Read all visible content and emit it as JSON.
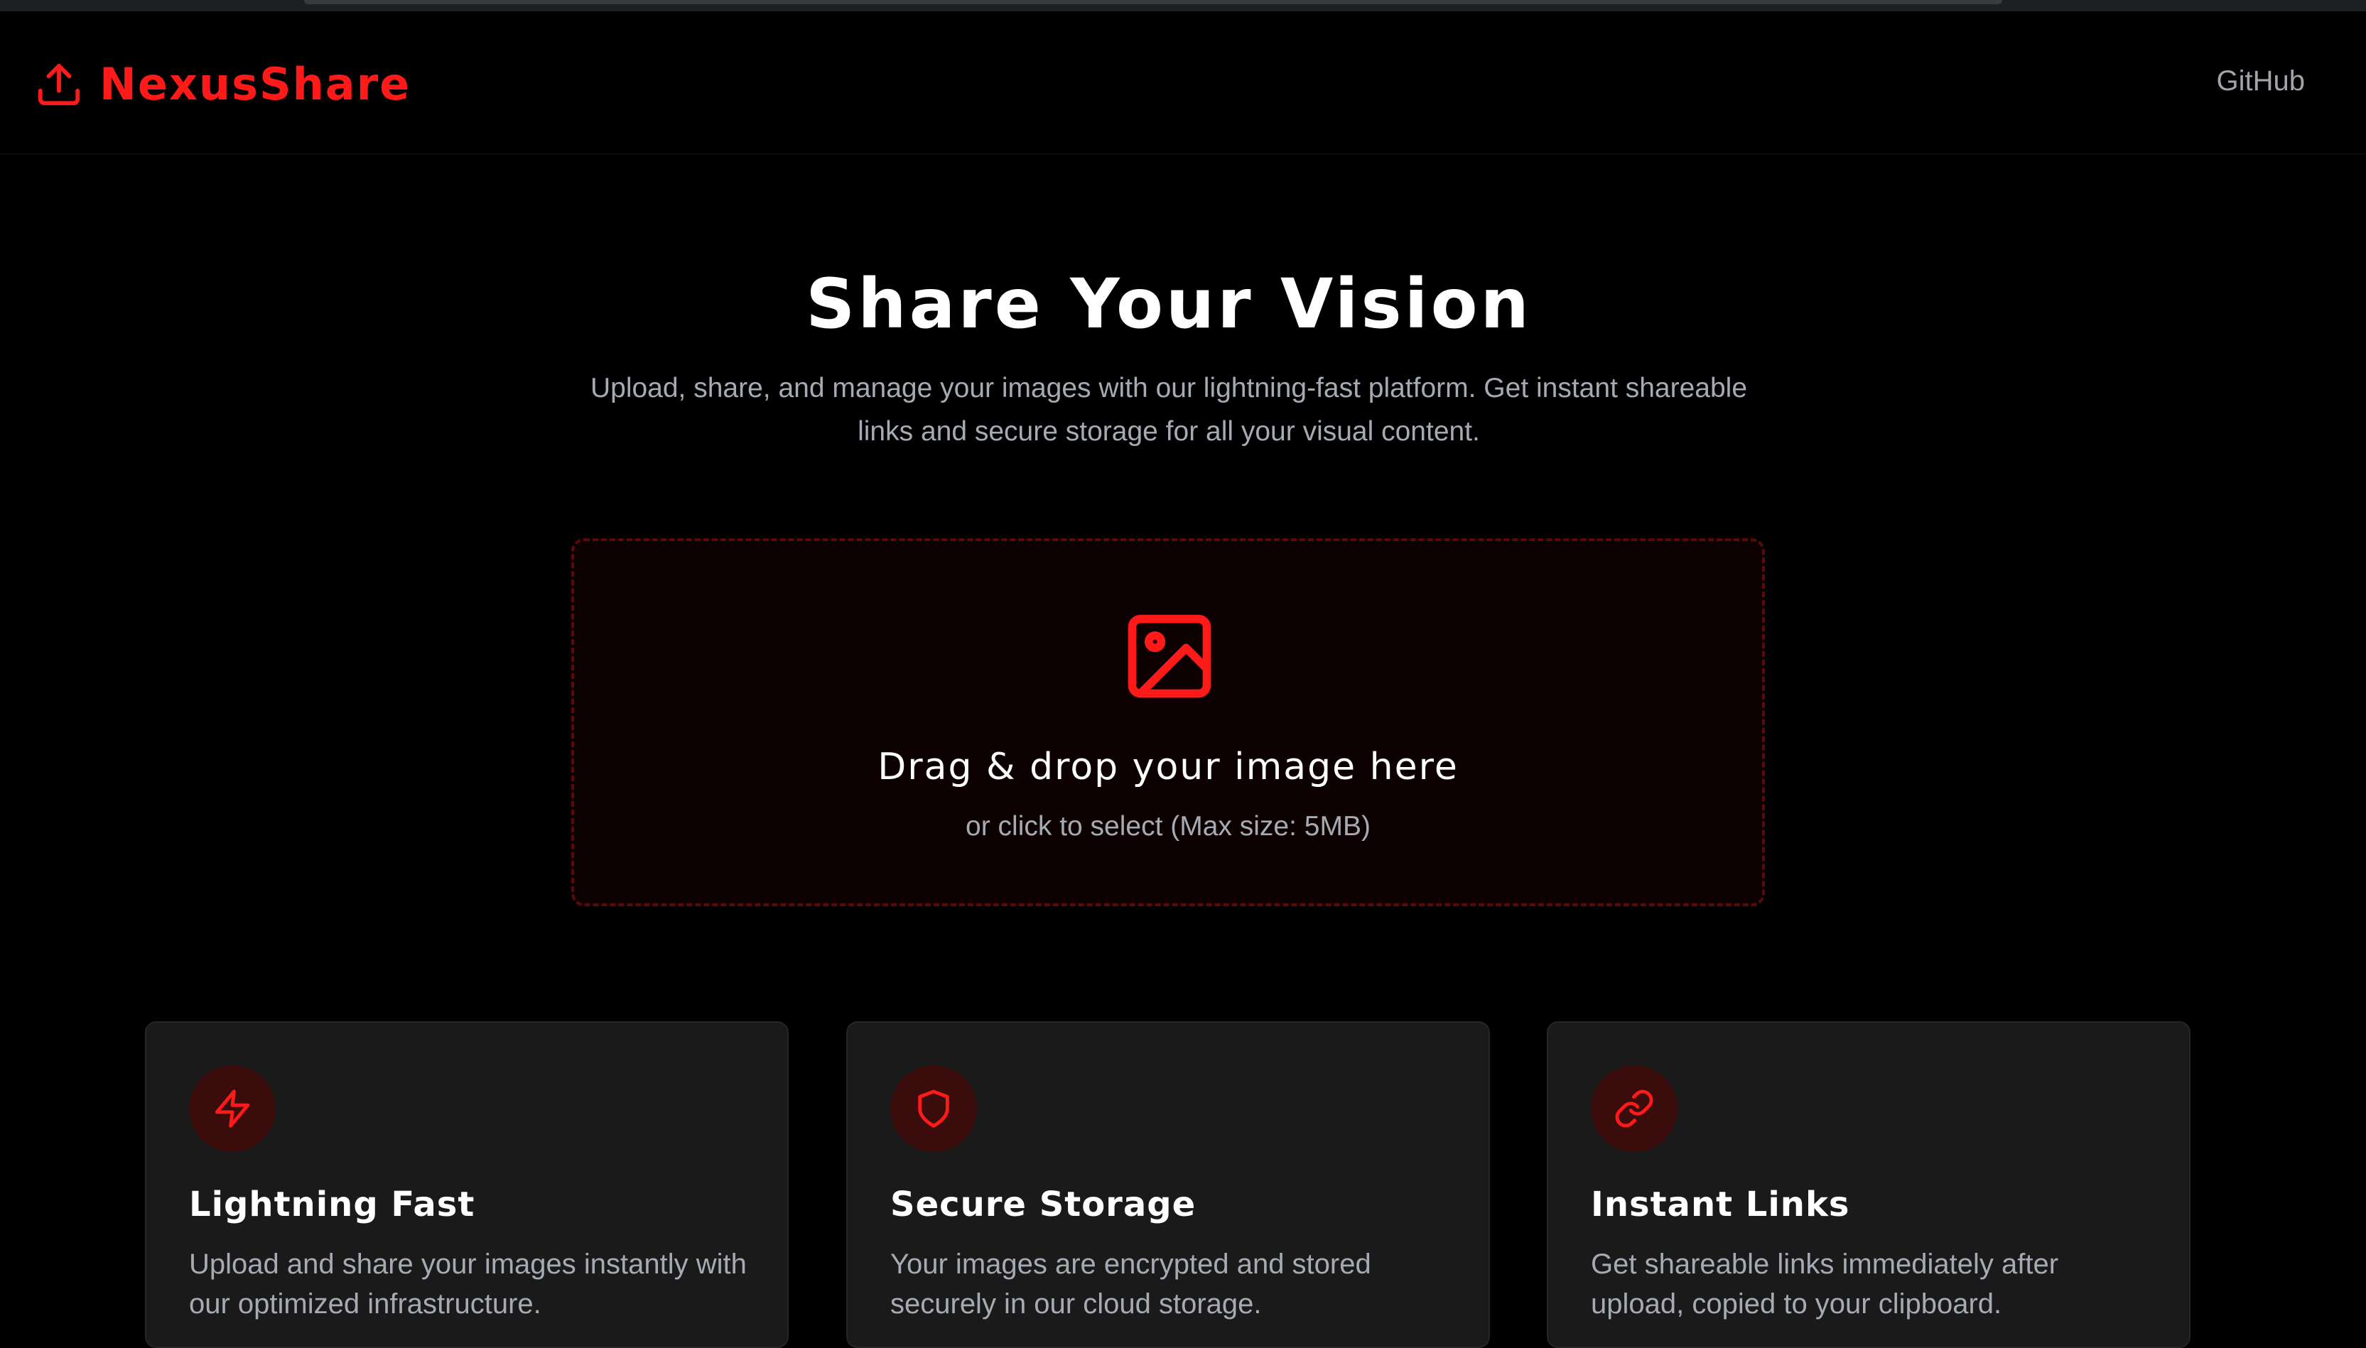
{
  "brand": {
    "name": "NexusShare",
    "icon": "upload-icon",
    "color": "#ff1a1a"
  },
  "nav": {
    "github_label": "GitHub"
  },
  "hero": {
    "title": "Share Your Vision",
    "subtitle": "Upload, share, and manage your images with our lightning-fast platform. Get instant shareable links and secure storage for all your visual content."
  },
  "upload": {
    "icon": "image-icon",
    "title": "Drag & drop your image here",
    "subtitle": "or click to select (Max size: 5MB)"
  },
  "features": [
    {
      "icon": "lightning-icon",
      "title": "Lightning Fast",
      "text": "Upload and share your images instantly with our optimized infrastructure."
    },
    {
      "icon": "shield-icon",
      "title": "Secure Storage",
      "text": "Your images are encrypted and stored securely in our cloud storage."
    },
    {
      "icon": "link-icon",
      "title": "Instant Links",
      "text": "Get shareable links immediately after upload, copied to your clipboard."
    }
  ],
  "colors": {
    "accent": "#ff1a1a",
    "background": "#000000",
    "card": "#1a1a1a",
    "muted_text": "#a6aab3"
  }
}
